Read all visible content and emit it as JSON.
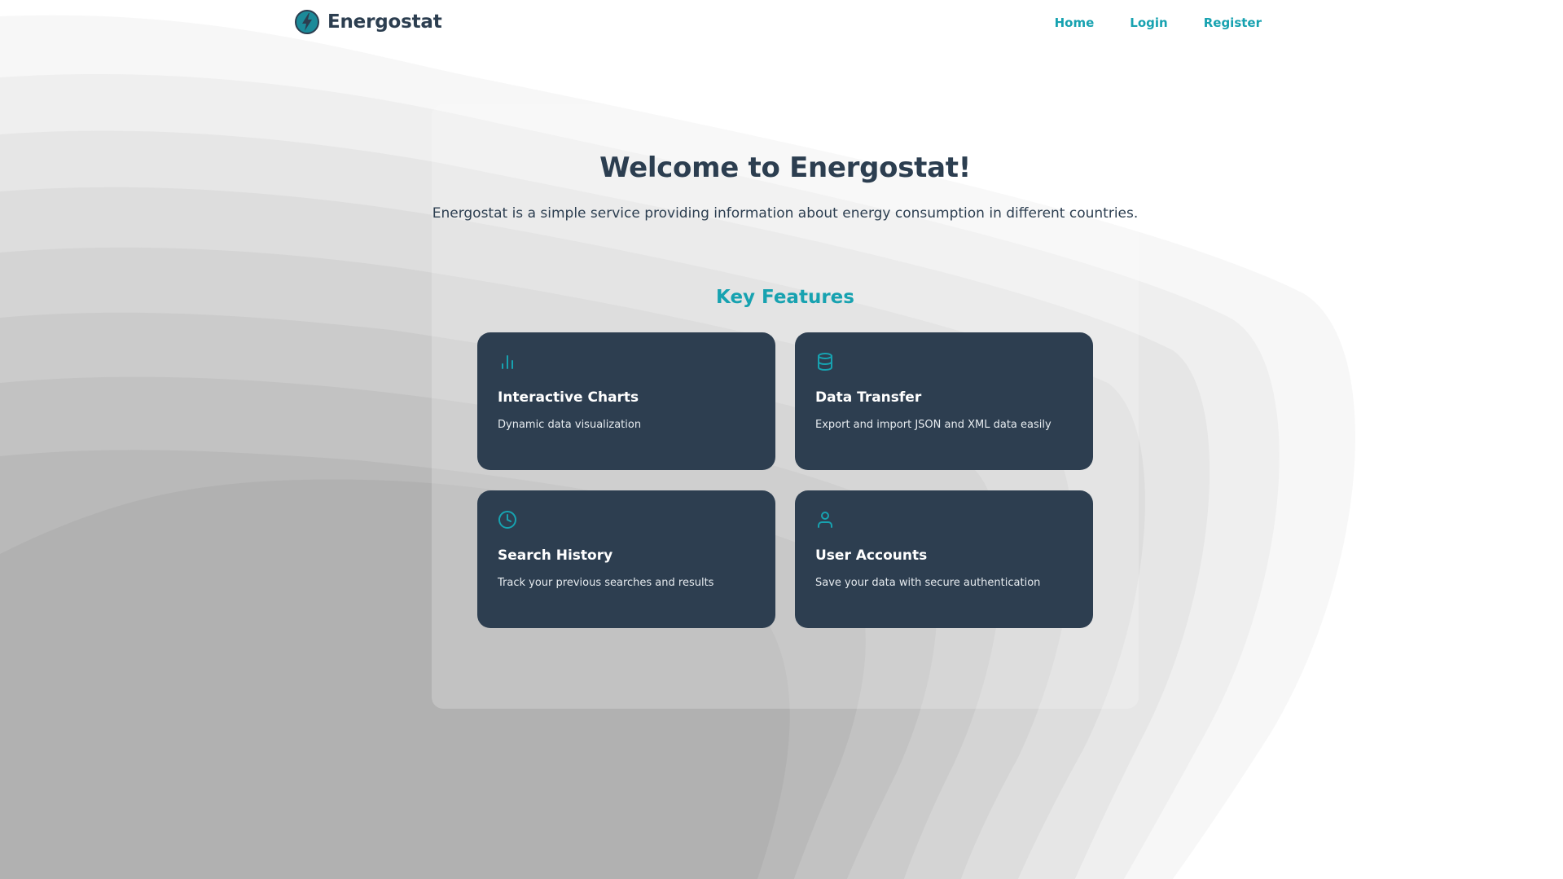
{
  "app": {
    "brand_name": "Energostat",
    "logo_icon": "lightning-bolt-icon"
  },
  "nav": {
    "items": [
      {
        "label": "Home"
      },
      {
        "label": "Login"
      },
      {
        "label": "Register"
      }
    ]
  },
  "hero": {
    "title": "Welcome to Energostat!",
    "description": "Energostat is a simple service providing information about energy consumption in different countries."
  },
  "features": {
    "heading": "Key Features",
    "items": [
      {
        "title": "Interactive Charts",
        "description": "Dynamic data visualization",
        "icon": "bar-chart-icon"
      },
      {
        "title": "Data Transfer",
        "description": "Export and import JSON and XML data easily",
        "icon": "database-icon"
      },
      {
        "title": "Search History",
        "description": "Track your previous searches and results",
        "icon": "clock-icon"
      },
      {
        "title": "User Accounts",
        "description": "Save your data with secure authentication",
        "icon": "user-icon"
      }
    ]
  },
  "colors": {
    "accent": "#17a2b0",
    "card_background": "#2d3e50",
    "text_dark": "#2c3e50"
  }
}
